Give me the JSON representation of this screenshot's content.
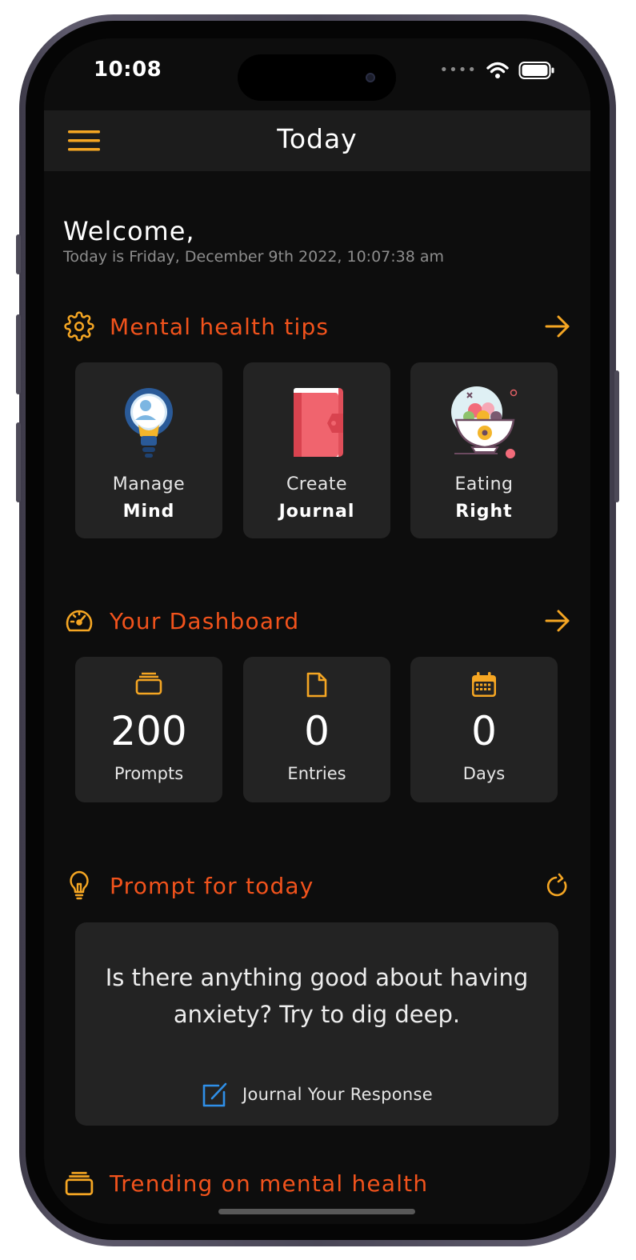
{
  "status_bar": {
    "time": "10:08"
  },
  "appbar": {
    "title": "Today"
  },
  "welcome": {
    "greeting": "Welcome,",
    "date_line": "Today is Friday, December 9th 2022, 10:07:38 am"
  },
  "tips_section": {
    "title": "Mental health tips",
    "cards": [
      {
        "line1": "Manage",
        "line2": "Mind",
        "icon": "lightbulb-head-icon"
      },
      {
        "line1": "Create",
        "line2": "Journal",
        "icon": "journal-book-icon"
      },
      {
        "line1": "Eating",
        "line2": "Right",
        "icon": "food-bowl-icon"
      }
    ]
  },
  "dashboard_section": {
    "title": "Your Dashboard",
    "stats": [
      {
        "value": "200",
        "label": "Prompts",
        "icon": "stack-icon"
      },
      {
        "value": "0",
        "label": "Entries",
        "icon": "file-icon"
      },
      {
        "value": "0",
        "label": "Days",
        "icon": "calendar-icon"
      }
    ]
  },
  "prompt_section": {
    "title": "Prompt for today",
    "prompt": "Is there anything good about having anxiety? Try to dig deep.",
    "action_label": "Journal Your Response"
  },
  "trending_section": {
    "title": "Trending on mental health"
  },
  "colors": {
    "accent": "#f5a623",
    "section_title": "#f2531c",
    "card_bg": "#232323",
    "appbar_bg": "#1c1c1c",
    "screen_bg": "#0d0d0d",
    "journal_icon": "#2f8fe8"
  }
}
